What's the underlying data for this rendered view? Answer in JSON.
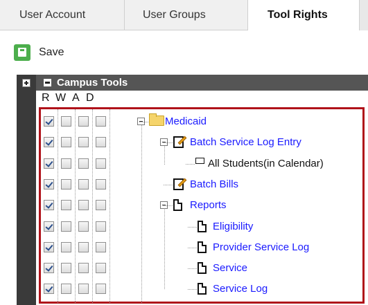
{
  "tabs": [
    {
      "label": "User Account"
    },
    {
      "label": "User Groups"
    },
    {
      "label": "Tool Rights"
    }
  ],
  "toolbar": {
    "save_label": "Save"
  },
  "section": {
    "title": "Campus Tools"
  },
  "columns": [
    "R",
    "W",
    "A",
    "D"
  ],
  "tree": [
    {
      "label": "Medicaid",
      "icon": "folder-icon",
      "checked": [
        true,
        false,
        false,
        false
      ]
    },
    {
      "label": "Batch Service Log Entry",
      "icon": "edit-icon",
      "checked": [
        true,
        false,
        false,
        false
      ]
    },
    {
      "label": "All Students(in Calendar)",
      "icon": "sub-icon",
      "checked": [
        true,
        false,
        false,
        false
      ]
    },
    {
      "label": "Batch Bills",
      "icon": "edit-icon",
      "checked": [
        true,
        false,
        false,
        false
      ]
    },
    {
      "label": "Reports",
      "icon": "page-icon",
      "checked": [
        true,
        false,
        false,
        false
      ]
    },
    {
      "label": "Eligibility",
      "icon": "page-icon",
      "checked": [
        true,
        false,
        false,
        false
      ]
    },
    {
      "label": "Provider Service Log",
      "icon": "page-icon",
      "checked": [
        true,
        false,
        false,
        false
      ]
    },
    {
      "label": "Service",
      "icon": "page-icon",
      "checked": [
        true,
        false,
        false,
        false
      ]
    },
    {
      "label": "Service Log",
      "icon": "page-icon",
      "checked": [
        true,
        false,
        false,
        false
      ]
    }
  ],
  "colors": {
    "selection_border": "#b0121a",
    "link": "#1a1aff",
    "save_green": "#4cae4c",
    "header_bg": "#555555"
  }
}
